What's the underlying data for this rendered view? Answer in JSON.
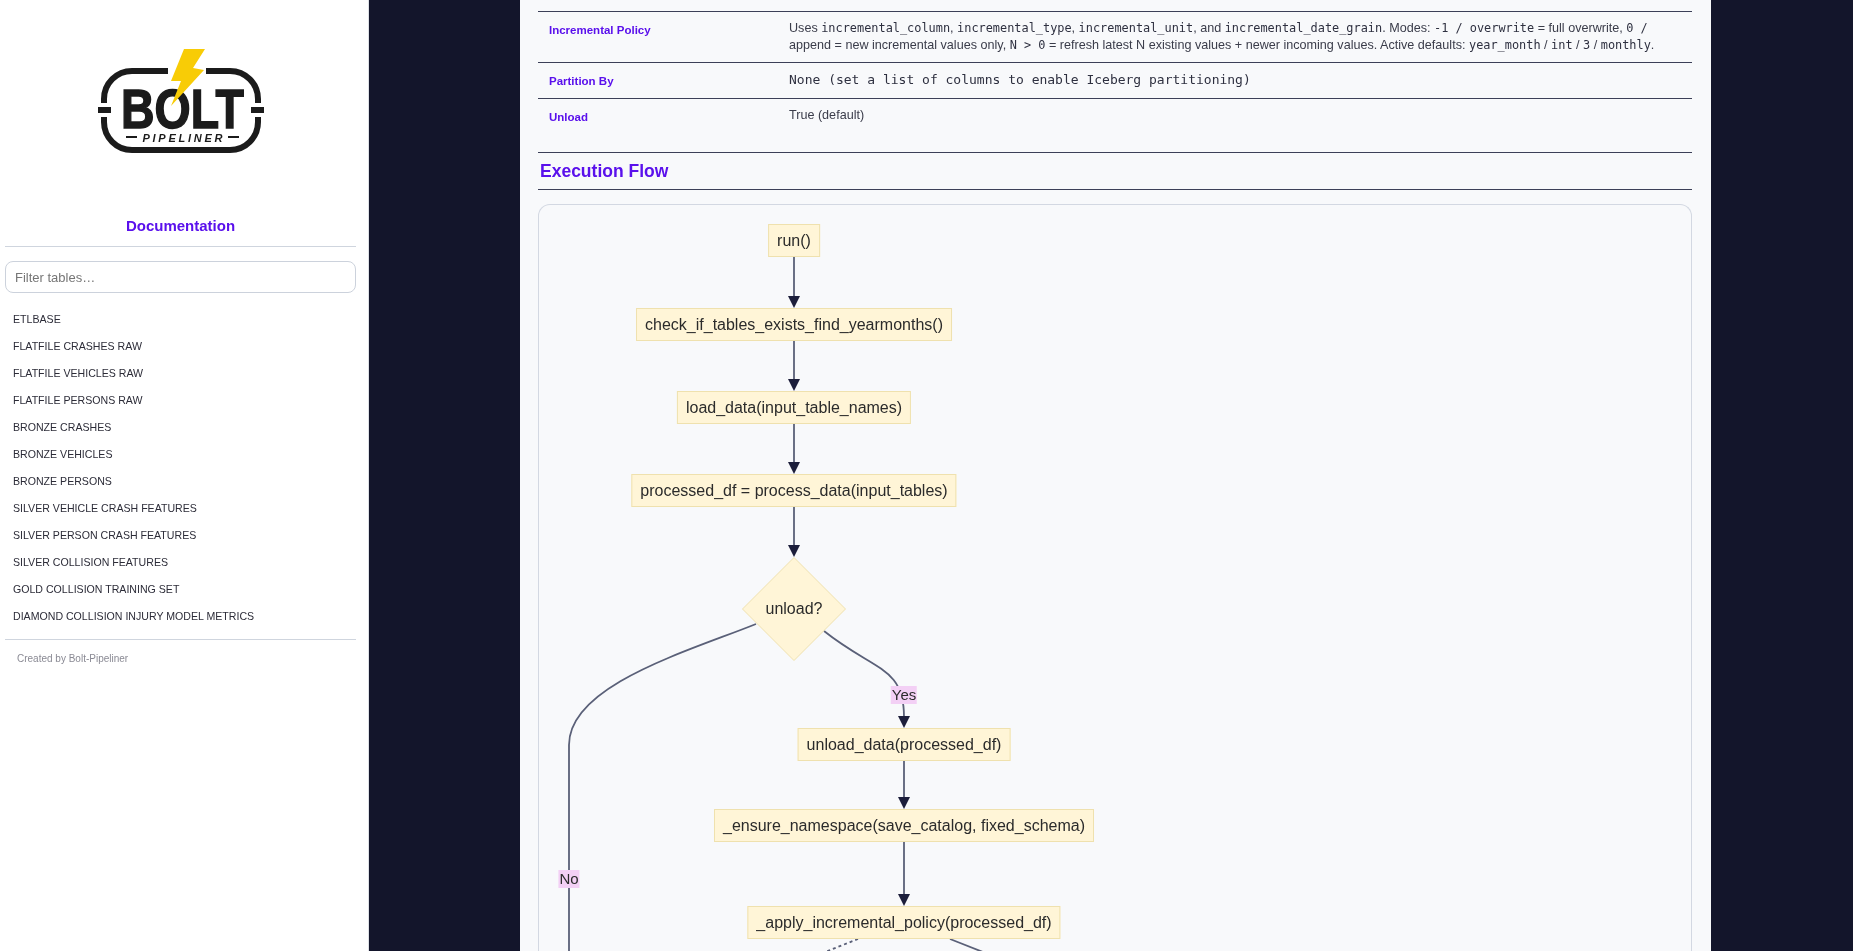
{
  "sidebar": {
    "logo": {
      "title": "BOLT",
      "subtitle": "PIPELINER"
    },
    "heading": "Documentation",
    "filter": {
      "placeholder": "Filter tables…"
    },
    "items": [
      {
        "label": "ETLBASE",
        "selected": false
      },
      {
        "label": "FLATFILE CRASHES RAW",
        "selected": false
      },
      {
        "label": "FLATFILE VEHICLES RAW",
        "selected": false
      },
      {
        "label": "FLATFILE PERSONS RAW",
        "selected": false
      },
      {
        "label": "BRONZE CRASHES",
        "selected": false
      },
      {
        "label": "BRONZE VEHICLES",
        "selected": false
      },
      {
        "label": "BRONZE PERSONS",
        "selected": false
      },
      {
        "label": "SILVER VEHICLE CRASH FEATURES",
        "selected": false
      },
      {
        "label": "SILVER PERSON CRASH FEATURES",
        "selected": false
      },
      {
        "label": "SILVER COLLISION FEATURES",
        "selected": false
      },
      {
        "label": "GOLD COLLISION TRAINING SET",
        "selected": false
      },
      {
        "label": "DIAMOND COLLISION INJURY MODEL METRICS",
        "selected": false
      }
    ],
    "footer": "Created by Bolt-Pipeliner"
  },
  "main": {
    "properties": [
      {
        "label": "Incremental Policy",
        "value": [
          {
            "text": "Uses ",
            "code": false
          },
          {
            "text": "incremental_column",
            "code": true
          },
          {
            "text": ", ",
            "code": false
          },
          {
            "text": "incremental_type",
            "code": true
          },
          {
            "text": ", ",
            "code": false
          },
          {
            "text": "incremental_unit",
            "code": true
          },
          {
            "text": ", and ",
            "code": false
          },
          {
            "text": "incremental_date_grain",
            "code": true
          },
          {
            "text": ". Modes: ",
            "code": false
          },
          {
            "text": "-1 / overwrite",
            "code": true
          },
          {
            "text": " = full overwrite, ",
            "code": false
          },
          {
            "text": "0 /",
            "code": true
          },
          {
            "text": " append = new incremental values only, ",
            "code": false
          },
          {
            "text": "N > 0",
            "code": true
          },
          {
            "text": " = refresh latest N existing values + newer incoming values. Active defaults: ",
            "code": false
          },
          {
            "text": "year_month",
            "code": true
          },
          {
            "text": " / ",
            "code": false
          },
          {
            "text": "int",
            "code": true
          },
          {
            "text": " / ",
            "code": false
          },
          {
            "text": "3",
            "code": true
          },
          {
            "text": " / ",
            "code": false
          },
          {
            "text": "monthly",
            "code": true
          },
          {
            "text": ".",
            "code": false
          }
        ]
      },
      {
        "label": "Partition By",
        "value": [
          {
            "text": "None (set a list of columns to enable Iceberg partitioning)",
            "code": true
          }
        ]
      },
      {
        "label": "Unload",
        "value": [
          {
            "text": "True (default)",
            "code": false
          }
        ]
      }
    ],
    "section_title": "Execution Flow",
    "flow": {
      "nodes": [
        {
          "kind": "process",
          "label": "run()"
        },
        {
          "kind": "process",
          "label": "check_if_tables_exists_find_yearmonths()"
        },
        {
          "kind": "process",
          "label": "load_data(input_table_names)"
        },
        {
          "kind": "process",
          "label": "processed_df = process_data(input_tables)"
        },
        {
          "kind": "decision",
          "label": "unload?"
        },
        {
          "kind": "process",
          "label": "unload_data(processed_df)"
        },
        {
          "kind": "process",
          "label": "_ensure_namespace(save_catalog, fixed_schema)"
        },
        {
          "kind": "process",
          "label": "_apply_incremental_policy(processed_df)"
        }
      ],
      "edges": [
        {
          "dashed": false
        },
        {
          "dashed": false
        },
        {
          "dashed": false
        },
        {
          "dashed": false
        },
        {
          "label": "Yes",
          "dashed": false
        },
        {
          "dashed": false
        },
        {
          "dashed": false
        },
        {
          "label": "No",
          "dashed": false
        },
        {
          "dashed": true
        },
        {
          "dashed": false
        }
      ]
    }
  }
}
